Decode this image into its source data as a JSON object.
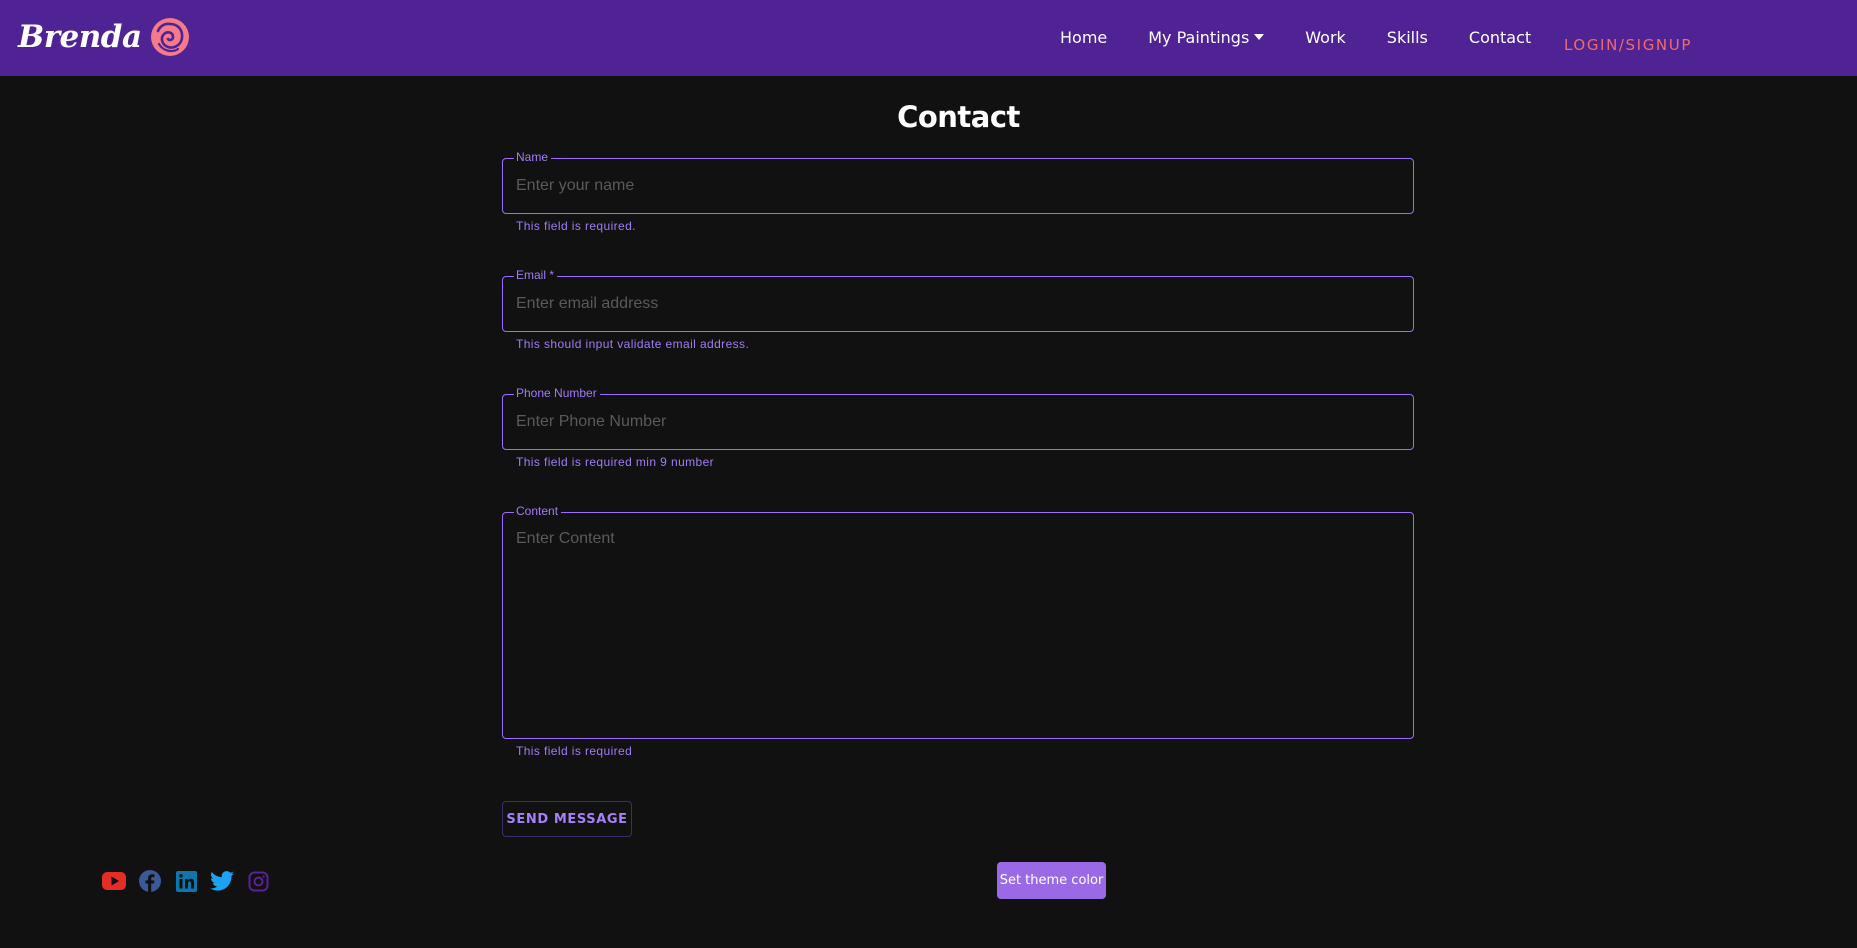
{
  "brand": {
    "name": "Brenda",
    "logo": "rose-icon"
  },
  "nav": {
    "items": [
      {
        "label": "Home"
      },
      {
        "label": "My Paintings",
        "icon": "caret-down-icon"
      },
      {
        "label": "Work"
      },
      {
        "label": "Skills"
      },
      {
        "label": "Contact"
      }
    ],
    "login_label": "LOGIN/SIGNUP"
  },
  "page": {
    "title": "Contact"
  },
  "form": {
    "name": {
      "label": "Name",
      "placeholder": "Enter your name",
      "helper": "This field is required."
    },
    "email": {
      "label": "Email *",
      "placeholder": "Enter email address",
      "helper": "This should input validate email address."
    },
    "phone": {
      "label": "Phone Number",
      "placeholder": "Enter Phone Number",
      "helper": "This field is required min 9 number"
    },
    "content": {
      "label": "Content",
      "placeholder": "Enter Content",
      "helper": "This field is required"
    },
    "submit_label": "SEND MESSAGE"
  },
  "footer": {
    "socials": [
      {
        "icon": "youtube-icon",
        "color": "#e52d27"
      },
      {
        "icon": "facebook-icon",
        "color": "#3b5998"
      },
      {
        "icon": "linkedin-icon",
        "color": "#0e76a8"
      },
      {
        "icon": "twitter-icon",
        "color": "#1da1f2"
      },
      {
        "icon": "instagram-icon",
        "color": "#5b2196"
      }
    ],
    "theme_button_label": "Set theme color"
  },
  "colors": {
    "navbar": "#4f2394",
    "background": "#111111",
    "accent": "#9b6cff",
    "login": "#f06b6b",
    "theme_button": "#9a6ae6"
  }
}
